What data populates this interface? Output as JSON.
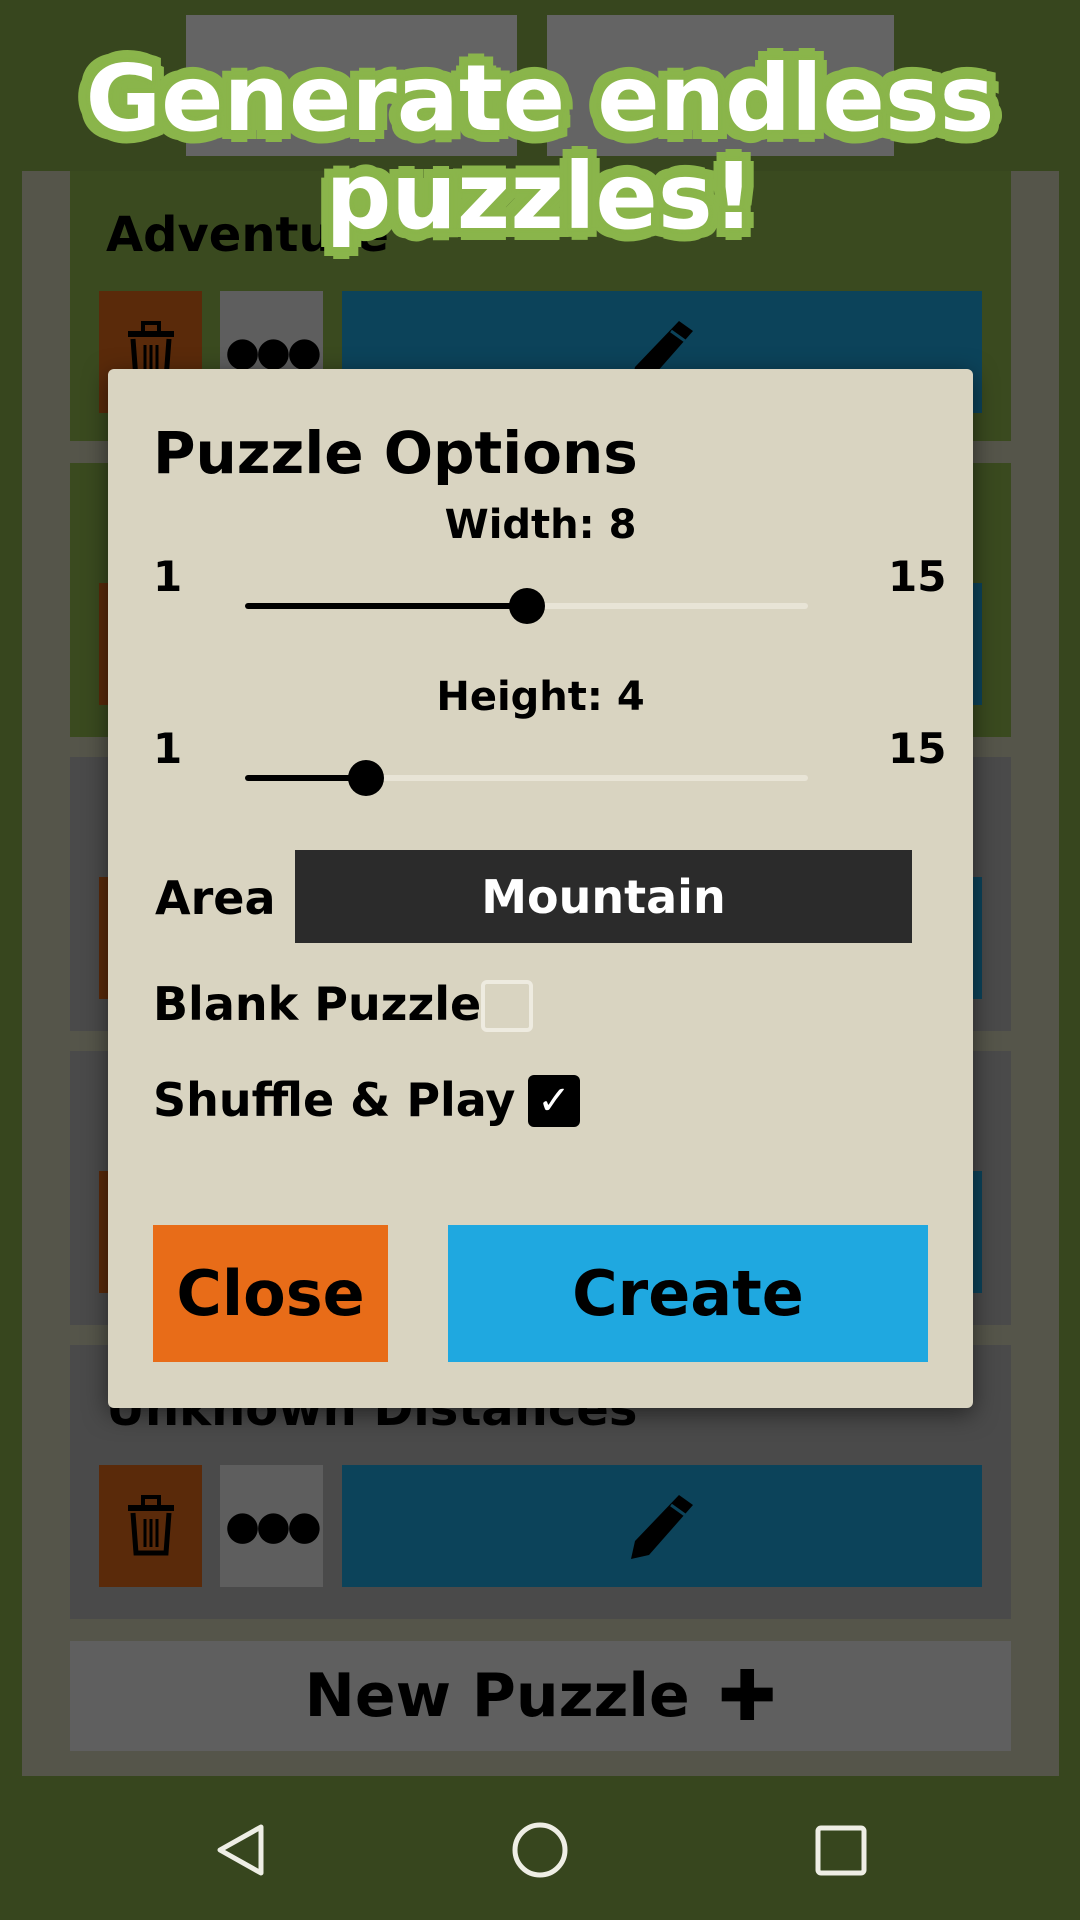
{
  "banner": {
    "headline_line1": "Generate endless",
    "headline_line2": "puzzles!"
  },
  "puzzle_list": {
    "cards": [
      {
        "title": "Adventure"
      },
      {
        "title": ""
      },
      {
        "title": ""
      },
      {
        "title": ""
      },
      {
        "title": "Unknown Distances"
      }
    ],
    "new_puzzle_label": "New Puzzle",
    "new_puzzle_icon": "plus-icon"
  },
  "dialog": {
    "title": "Puzzle Options",
    "width": {
      "label": "Width: 8",
      "value": 8,
      "min": "1",
      "max": "15"
    },
    "height": {
      "label": "Height: 4",
      "value": 4,
      "min": "1",
      "max": "15"
    },
    "area_label": "Area",
    "area_value": "Mountain",
    "blank_puzzle_label": "Blank Puzzle",
    "blank_puzzle_checked": false,
    "shuffle_label": "Shuffle & Play",
    "shuffle_checked": true,
    "close_label": "Close",
    "create_label": "Create"
  },
  "colors": {
    "close": "#e86c18",
    "create": "#1fa8e0",
    "dialog": "#d9d4c1",
    "outline": "#8ab54b"
  },
  "navbar": {
    "back": "back-icon",
    "home": "home-icon",
    "recents": "recents-icon"
  }
}
